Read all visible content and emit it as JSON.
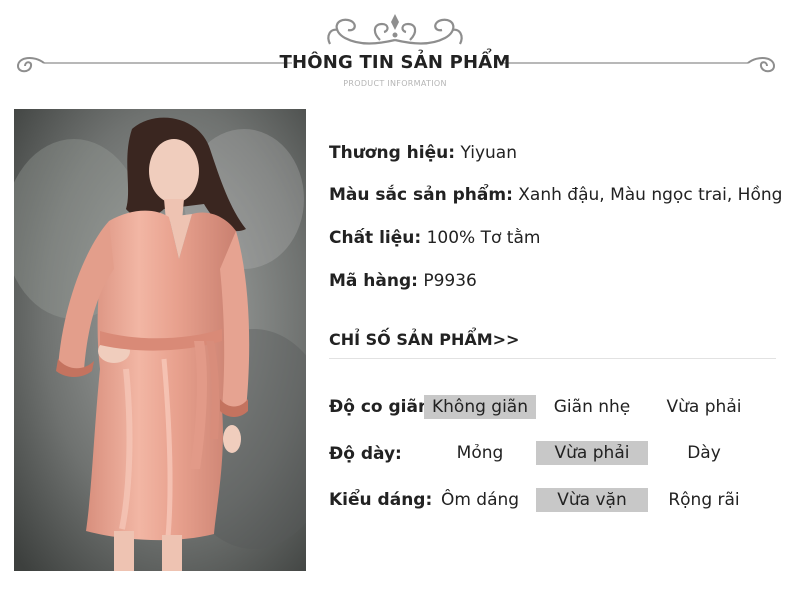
{
  "header": {
    "title": "THÔNG TIN SẢN PHẨM",
    "subtitle": "PRODUCT INFORMATION"
  },
  "product": {
    "brand_label": "Thương hiệu:",
    "brand_value": "Yiyuan",
    "color_label": "Màu sắc sản phẩm:",
    "color_value": "Xanh đậu, Màu ngọc trai, Hồng",
    "material_label": "Chất liệu:",
    "material_value": "100% Tơ tằm",
    "code_label": "Mã hàng:",
    "code_value": "P9936"
  },
  "specs": {
    "title": "CHỈ SỐ SẢN PHẨM>>",
    "rows": [
      {
        "label": "Độ co giãn:",
        "options": [
          "Không giãn",
          "Giãn nhẹ",
          "Vừa phải"
        ],
        "selected": 0
      },
      {
        "label": "Độ dày:",
        "options": [
          "Mỏng",
          "Vừa phải",
          "Dày"
        ],
        "selected": 1
      },
      {
        "label": "Kiểu dáng:",
        "options": [
          "Ôm dáng",
          "Vừa vặn",
          "Rộng rãi"
        ],
        "selected": 1
      }
    ]
  },
  "colors": {
    "selected_bg": "#c8c8c8",
    "robe": "#eda896",
    "ornament": "#8e8e8e"
  }
}
